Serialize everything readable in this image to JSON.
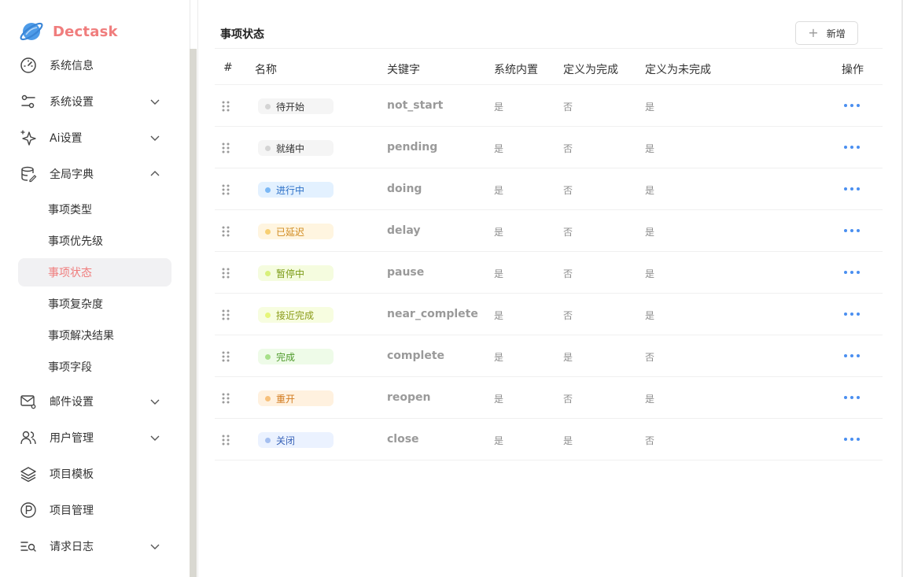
{
  "brand": {
    "name": "Dectask",
    "color": "#f07d7d"
  },
  "sidebar": {
    "items": [
      {
        "label": "系统信息",
        "icon": "dashboard-gauge-icon",
        "has_chevron": false
      },
      {
        "label": "系统设置",
        "icon": "settings-sliders-icon",
        "has_chevron": true,
        "expanded": false
      },
      {
        "label": "Ai设置",
        "icon": "ai-sparkle-icon",
        "has_chevron": true,
        "expanded": false
      },
      {
        "label": "全局字典",
        "icon": "database-edit-icon",
        "has_chevron": true,
        "expanded": true
      },
      {
        "label": "邮件设置",
        "icon": "mail-settings-icon",
        "has_chevron": true,
        "expanded": false
      },
      {
        "label": "用户管理",
        "icon": "users-icon",
        "has_chevron": true,
        "expanded": false
      },
      {
        "label": "项目模板",
        "icon": "layers-icon",
        "has_chevron": false
      },
      {
        "label": "项目管理",
        "icon": "project-p-icon",
        "has_chevron": false
      },
      {
        "label": "请求日志",
        "icon": "log-search-icon",
        "has_chevron": true,
        "expanded": false
      }
    ],
    "sub_items": [
      {
        "label": "事项类型",
        "active": false
      },
      {
        "label": "事项优先级",
        "active": false
      },
      {
        "label": "事项状态",
        "active": true
      },
      {
        "label": "事项复杂度",
        "active": false
      },
      {
        "label": "事项解决结果",
        "active": false
      },
      {
        "label": "事项字段",
        "active": false
      }
    ]
  },
  "main": {
    "title": "事项状态",
    "add_button": {
      "label": "新增",
      "icon": "plus-icon"
    },
    "columns": [
      "#",
      "名称",
      "关键字",
      "系统内置",
      "定义为完成",
      "定义为未完成",
      "操作"
    ],
    "rows": [
      {
        "name": "待开始",
        "key": "not_start",
        "builtin": "是",
        "done": "否",
        "undone": "是",
        "tag_bg": "#f5f5f5",
        "dot": "#d4d4d4",
        "text_color": "#333333"
      },
      {
        "name": "就绪中",
        "key": "pending",
        "builtin": "是",
        "done": "否",
        "undone": "是",
        "tag_bg": "#f5f5f5",
        "dot": "#d4d4d4",
        "text_color": "#333333"
      },
      {
        "name": "进行中",
        "key": "doing",
        "builtin": "是",
        "done": "否",
        "undone": "是",
        "tag_bg": "#e3f1ff",
        "dot": "#7bb8f5",
        "text_color": "#2b6fc7"
      },
      {
        "name": "已延迟",
        "key": "delay",
        "builtin": "是",
        "done": "否",
        "undone": "是",
        "tag_bg": "#fff5e0",
        "dot": "#f7cf72",
        "text_color": "#d08a1f"
      },
      {
        "name": "暂停中",
        "key": "pause",
        "builtin": "是",
        "done": "否",
        "undone": "是",
        "tag_bg": "#f5fcdf",
        "dot": "#d8f07a",
        "text_color": "#7a9a14"
      },
      {
        "name": "接近完成",
        "key": "near_complete",
        "builtin": "是",
        "done": "否",
        "undone": "是",
        "tag_bg": "#f7fde0",
        "dot": "#e6f67a",
        "text_color": "#8a9b17"
      },
      {
        "name": "完成",
        "key": "complete",
        "builtin": "是",
        "done": "是",
        "undone": "否",
        "tag_bg": "#eefbe8",
        "dot": "#a7e08a",
        "text_color": "#4f9a2b"
      },
      {
        "name": "重开",
        "key": "reopen",
        "builtin": "是",
        "done": "否",
        "undone": "是",
        "tag_bg": "#fff1df",
        "dot": "#f7c07a",
        "text_color": "#d27a1d"
      },
      {
        "name": "关闭",
        "key": "close",
        "builtin": "是",
        "done": "是",
        "undone": "否",
        "tag_bg": "#ebf2ff",
        "dot": "#a5bff0",
        "text_color": "#3a64b8"
      }
    ],
    "row_action_icon": "more-dots-icon",
    "accent": "#4a8ff0"
  }
}
